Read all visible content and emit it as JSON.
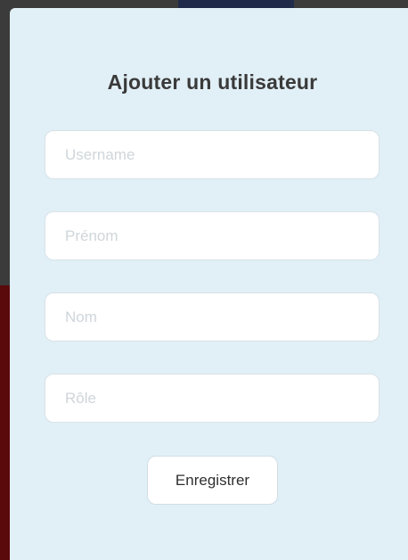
{
  "modal": {
    "title": "Ajouter un utilisateur",
    "fields": [
      {
        "placeholder": "Username",
        "value": ""
      },
      {
        "placeholder": "Prénom",
        "value": ""
      },
      {
        "placeholder": "Nom",
        "value": ""
      },
      {
        "placeholder": "Rôle",
        "value": ""
      }
    ],
    "save_label": "Enregistrer"
  },
  "colors": {
    "modal_background": "#e1eff6",
    "input_background": "#ffffff",
    "title_text": "#3a3a3a",
    "placeholder_text": "#cfd6db"
  }
}
